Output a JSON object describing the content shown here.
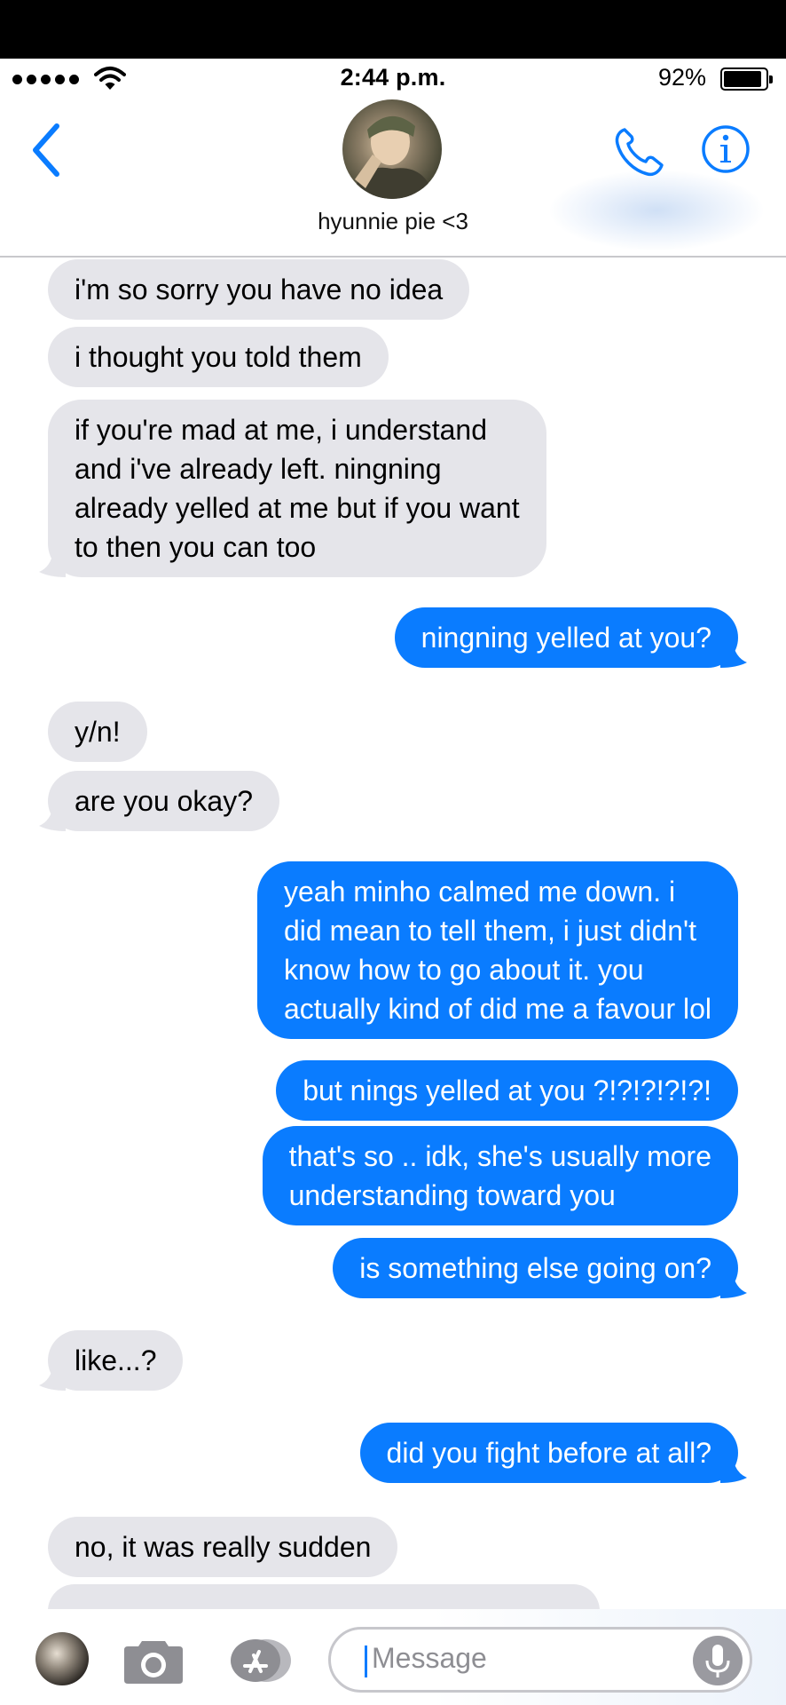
{
  "status_bar": {
    "time": "2:44 p.m.",
    "battery_percent": "92%",
    "battery_level": 0.92,
    "signal_bars": 5
  },
  "header": {
    "contact_name": "hyunnie pie <3",
    "back_icon": "chevron-left-icon",
    "call_icon": "phone-icon",
    "info_icon": "info-icon"
  },
  "messages": [
    {
      "side": "received",
      "text": "i'm so sorry you have no idea"
    },
    {
      "side": "received",
      "text": "i thought you told them"
    },
    {
      "side": "received",
      "lines": [
        "if you're mad at me, i understand",
        "and i've already left. ningning",
        "already yelled at me but if you want",
        "to then you can too"
      ]
    },
    {
      "side": "sent",
      "text": "ningning yelled at you?"
    },
    {
      "side": "received",
      "text": "y/n!"
    },
    {
      "side": "received",
      "text": "are you okay?"
    },
    {
      "side": "sent",
      "lines": [
        "yeah minho calmed me down. i",
        "did mean to tell them, i just didn't",
        "know how to go about it. you",
        "actually kind of did me a favour lol"
      ]
    },
    {
      "side": "sent",
      "text": "but nings yelled at you ?!?!?!?!?!"
    },
    {
      "side": "sent",
      "lines": [
        "that's so .. idk, she's usually more",
        "understanding toward you"
      ]
    },
    {
      "side": "sent",
      "text": "is something else going on?"
    },
    {
      "side": "received",
      "text": "like...?"
    },
    {
      "side": "sent",
      "text": "did you fight before at all?"
    },
    {
      "side": "received",
      "text": "no, it was really sudden"
    }
  ],
  "composer": {
    "placeholder": "Message",
    "camera_icon": "camera-icon",
    "apps_icon": "app-store-icon",
    "mic_icon": "microphone-icon"
  },
  "colors": {
    "sent_bubble": "#0a7cff",
    "received_bubble": "#e5e5ea",
    "accent": "#0a7cff"
  }
}
